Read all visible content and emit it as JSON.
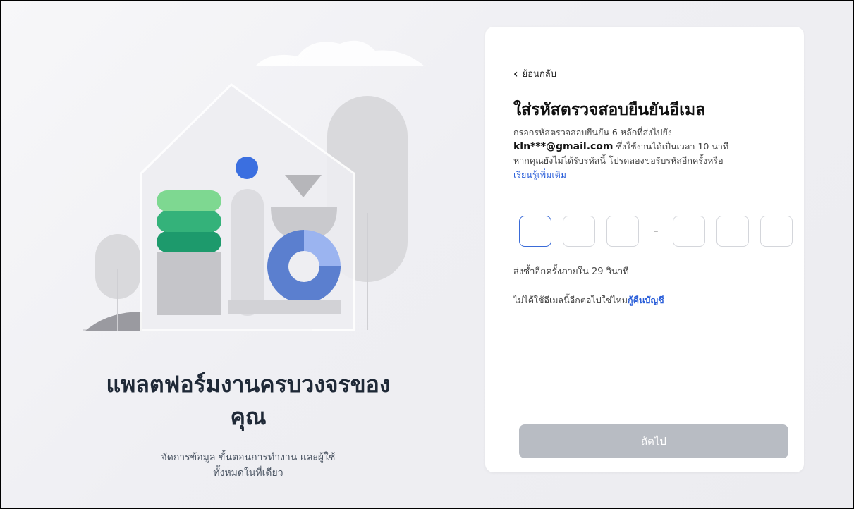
{
  "hero": {
    "title_line1": "แพลตฟอร์มงานครบวงจรของ",
    "title_line2": "คุณ",
    "subtitle_line1": "จัดการข้อมูล ขั้นตอนการทำงาน และผู้ใช้",
    "subtitle_line2": "ทั้งหมดในที่เดียว"
  },
  "card": {
    "back_label": "ย้อนกลับ",
    "title": "ใส่รหัสตรวจสอบยืนยันอีเมล",
    "desc_line1": "กรอกรหัสตรวจสอบยืนยัน 6 หลักที่ส่งไปยัง",
    "email": "kln***@gmail.com",
    "desc_line2_rest": " ซึ่งใช้งานได้เป็นเวลา 10 นาที",
    "desc_line3": "หากคุณยังไม่ได้รับรหัสนี้ โปรดลองขอรับรหัสอีกครั้งหรือ",
    "learn_more": "เรียนรู้เพิ่มเติม",
    "otp_separator": "–",
    "resend_text": "ส่งซ้ำอีกครั้งภายใน 29 วินาที",
    "no_email_text": "ไม่ได้ใช้อีเมลนี้อีกต่อไปใช่ไหม",
    "recover_link": "กู้คืนบัญชี",
    "next_label": "ถัดไป"
  },
  "colors": {
    "accent": "#2b5fd9",
    "button_disabled": "#b8bcc3",
    "green_light": "#7ed891",
    "green_mid": "#34b27a",
    "green_dark": "#1d9a6c",
    "blue": "#3b6fe0",
    "donut_dark": "#5b7fcf",
    "donut_light": "#9bb4f0"
  }
}
